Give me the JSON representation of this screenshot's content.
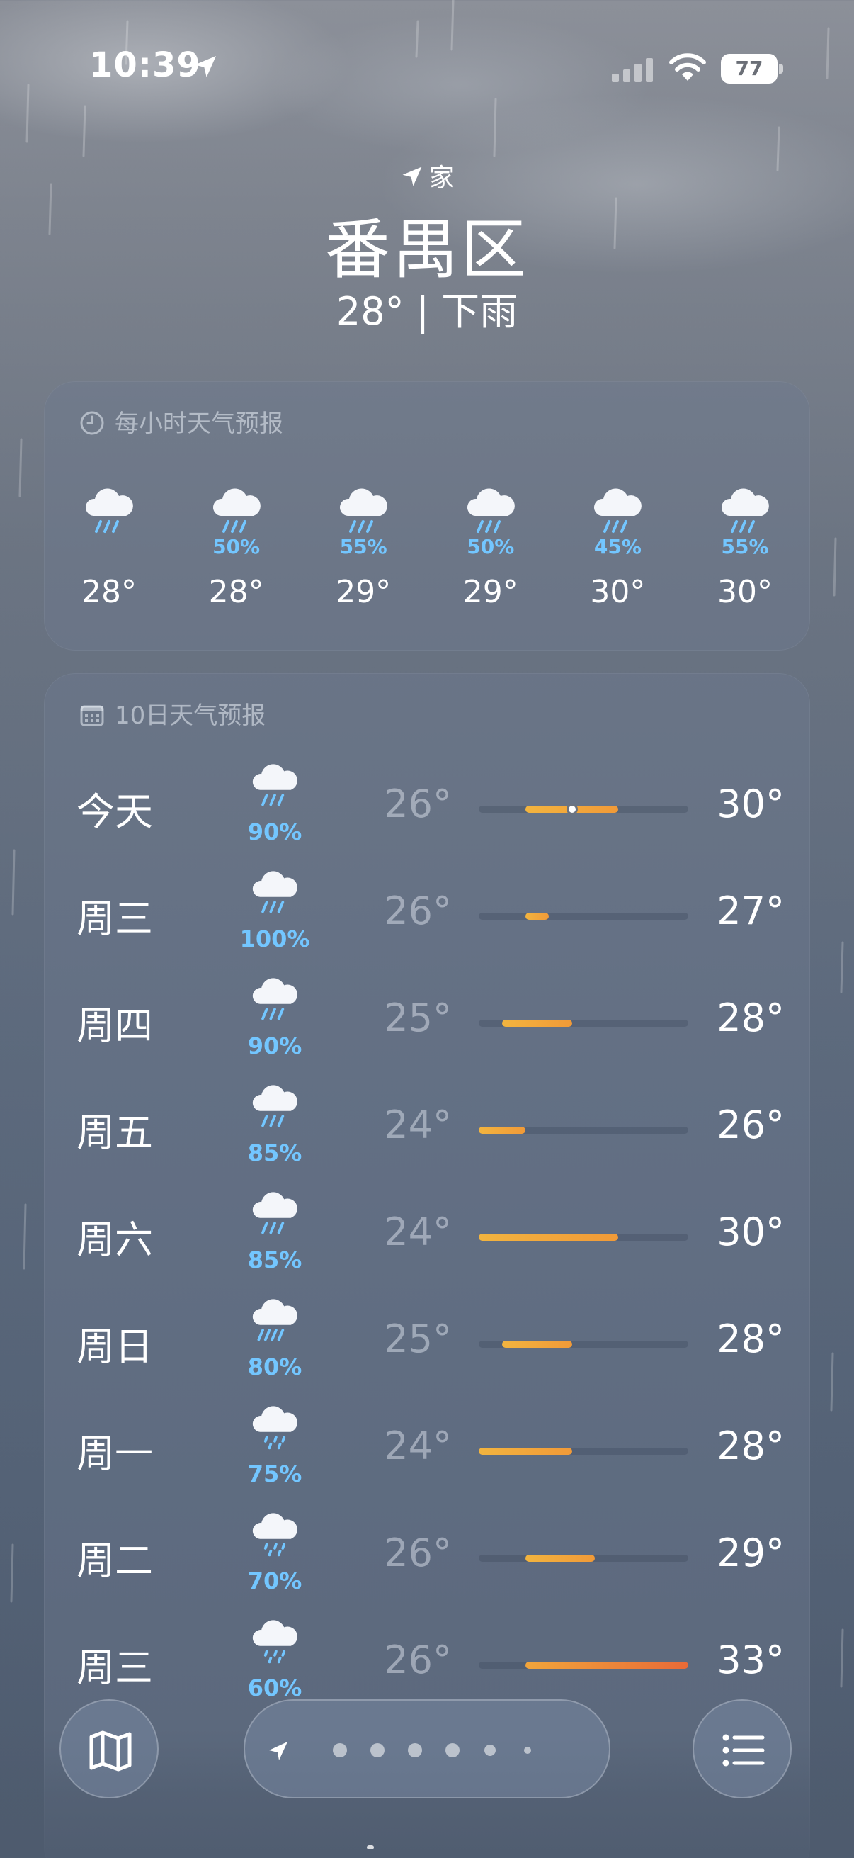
{
  "status_bar": {
    "time": "10:39",
    "battery": "77"
  },
  "header": {
    "home_label": "家",
    "city": "番禺区",
    "current": "28° | 下雨"
  },
  "hourly": {
    "title": "每小时天气预报",
    "items": [
      {
        "icon": "rain-cloud-icon",
        "pct": "",
        "temp": "28°"
      },
      {
        "icon": "rain-cloud-icon",
        "pct": "50%",
        "temp": "28°"
      },
      {
        "icon": "rain-cloud-icon",
        "pct": "55%",
        "temp": "29°"
      },
      {
        "icon": "rain-cloud-icon",
        "pct": "50%",
        "temp": "29°"
      },
      {
        "icon": "rain-cloud-icon",
        "pct": "45%",
        "temp": "30°"
      },
      {
        "icon": "rain-cloud-icon",
        "pct": "55%",
        "temp": "30°"
      }
    ]
  },
  "daily": {
    "title": "10日天气预报",
    "range_min": 24,
    "range_max": 33,
    "current_temp": 28,
    "days": [
      {
        "name": "今天",
        "icon": "rain-cloud-icon",
        "pct": "90%",
        "low": "26°",
        "high": "30°",
        "low_value": 26,
        "high_value": 30
      },
      {
        "name": "周三",
        "icon": "rain-cloud-icon",
        "pct": "100%",
        "low": "26°",
        "high": "27°",
        "low_value": 26,
        "high_value": 27
      },
      {
        "name": "周四",
        "icon": "rain-cloud-icon",
        "pct": "90%",
        "low": "25°",
        "high": "28°",
        "low_value": 25,
        "high_value": 28
      },
      {
        "name": "周五",
        "icon": "rain-cloud-icon",
        "pct": "85%",
        "low": "24°",
        "high": "26°",
        "low_value": 24,
        "high_value": 26
      },
      {
        "name": "周六",
        "icon": "rain-cloud-icon",
        "pct": "85%",
        "low": "24°",
        "high": "30°",
        "low_value": 24,
        "high_value": 30
      },
      {
        "name": "周日",
        "icon": "heavy-rain-cloud-icon",
        "pct": "80%",
        "low": "25°",
        "high": "28°",
        "low_value": 25,
        "high_value": 28
      },
      {
        "name": "周一",
        "icon": "drizzle-cloud-icon",
        "pct": "75%",
        "low": "24°",
        "high": "28°",
        "low_value": 24,
        "high_value": 28
      },
      {
        "name": "周二",
        "icon": "drizzle-cloud-icon",
        "pct": "70%",
        "low": "26°",
        "high": "29°",
        "low_value": 26,
        "high_value": 29
      },
      {
        "name": "周三",
        "icon": "drizzle-cloud-icon",
        "pct": "60%",
        "low": "26°",
        "high": "33°",
        "low_value": 26,
        "high_value": 33
      }
    ]
  },
  "bottom_bar": {
    "page_count": 7,
    "active_page": 0
  },
  "colors": {
    "precip": "#73c6ff",
    "range_warm": "#f2b43f",
    "range_hot": "#e86a37"
  }
}
